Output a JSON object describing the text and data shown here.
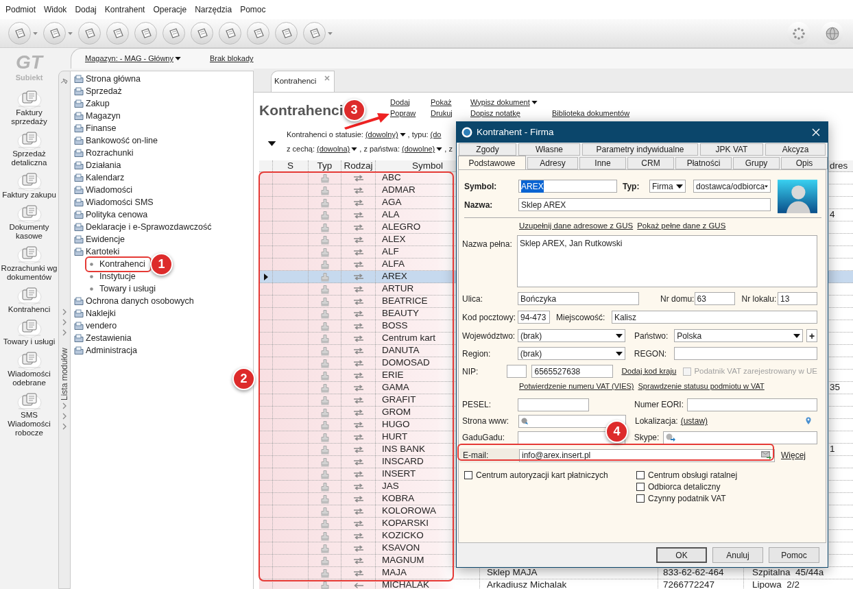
{
  "menu": [
    "Podmiot",
    "Widok",
    "Dodaj",
    "Kontrahent",
    "Operacje",
    "Narzędzia",
    "Pomoc"
  ],
  "toolbar": [
    {
      "dropdown": true
    },
    {
      "dropdown": true
    },
    {
      "dropdown": false
    },
    {
      "dropdown": false
    },
    {
      "dropdown": false
    },
    {
      "dropdown": false
    },
    {
      "dropdown": false
    },
    {
      "dropdown": false
    },
    {
      "dropdown": false
    },
    {
      "dropdown": false
    },
    {
      "dropdown": true
    }
  ],
  "logo": {
    "mark": "GT",
    "name": "Subiekt"
  },
  "nav": [
    "Faktury sprzedaży",
    "Sprzedaż detaliczna",
    "Faktury zakupu",
    "Dokumenty kasowe",
    "Rozrachunki wg dokumentów",
    "Kontrahenci",
    "Towary i usługi",
    "Wiadomości odebrane",
    "SMS Wiadomości robocze"
  ],
  "band": {
    "warehouse": "Magazyn: - MAG - Główny",
    "lock": "Brak blokady"
  },
  "modules": {
    "strip_label": "Lista modułów",
    "items": [
      {
        "label": "Strona główna"
      },
      {
        "label": "Sprzedaż"
      },
      {
        "label": "Zakup"
      },
      {
        "label": "Magazyn"
      },
      {
        "label": "Finanse"
      },
      {
        "label": "Bankowość on-line"
      },
      {
        "label": "Rozrachunki"
      },
      {
        "label": "Działania"
      },
      {
        "label": "Kalendarz"
      },
      {
        "label": "Wiadomości"
      },
      {
        "label": "Wiadomości SMS"
      },
      {
        "label": "Polityka cenowa"
      },
      {
        "label": "Deklaracje i e-Sprawozdawczość"
      },
      {
        "label": "Ewidencje"
      },
      {
        "label": "Kartoteki",
        "children": [
          {
            "label": "Kontrahenci"
          },
          {
            "label": "Instytucje"
          },
          {
            "label": "Towary i usługi"
          }
        ]
      },
      {
        "label": "Ochrona danych osobowych"
      },
      {
        "label": "Naklejki"
      },
      {
        "label": "vendero"
      },
      {
        "label": "Zestawienia"
      },
      {
        "label": "Administracja"
      }
    ]
  },
  "tab": {
    "label": "Kontrahenci"
  },
  "heading": "Kontrahenci",
  "actions": [
    [
      {
        "label": "Dodaj",
        "dropdown": false
      },
      {
        "label": "Pokaż",
        "dropdown": false
      },
      {
        "label": "Wypisz dokument",
        "dropdown": true
      }
    ],
    [
      {
        "label": "Popraw",
        "dropdown": false
      },
      {
        "label": "Drukuj",
        "dropdown": false
      },
      {
        "label": "Dopisz notatkę",
        "dropdown": false
      },
      {
        "label": "Biblioteka dokumentów",
        "dropdown": false
      }
    ]
  ],
  "filters": [
    [
      {
        "kind": "text",
        "text": "Kontrahenci o statusie:"
      },
      {
        "kind": "choice",
        "text": "(dowolny)"
      },
      {
        "kind": "text",
        "text": ", typu:"
      },
      {
        "kind": "cut",
        "text": "(do"
      }
    ],
    [
      {
        "kind": "text",
        "text": "z cechą:"
      },
      {
        "kind": "choice",
        "text": "(dowolna)"
      },
      {
        "kind": "text",
        "text": ", z państwa:"
      },
      {
        "kind": "choice",
        "text": "(dowolne)"
      },
      {
        "kind": "text",
        "text": ", z"
      }
    ]
  ],
  "table": {
    "columns": {
      "s": "S",
      "typ": "Typ",
      "rodzaj": "Rodzaj",
      "symbol": "Symbol",
      "column_8": "dres"
    },
    "rows": [
      {
        "symbol": "ABC",
        "kind": "both",
        "selected": false
      },
      {
        "symbol": "ADMAR",
        "kind": "both",
        "selected": false
      },
      {
        "symbol": "AGA",
        "kind": "both",
        "selected": false
      },
      {
        "symbol": "ALA",
        "kind": "both",
        "selected": false,
        "adres": "4"
      },
      {
        "symbol": "ALEGRO",
        "kind": "both",
        "selected": false
      },
      {
        "symbol": "ALEX",
        "kind": "both",
        "selected": false
      },
      {
        "symbol": "ALF",
        "kind": "both",
        "selected": false
      },
      {
        "symbol": "ALFA",
        "kind": "both",
        "selected": false
      },
      {
        "symbol": "AREX",
        "kind": "both",
        "selected": true
      },
      {
        "symbol": "ARTUR",
        "kind": "both",
        "selected": false
      },
      {
        "symbol": "BEATRICE",
        "kind": "both",
        "selected": false
      },
      {
        "symbol": "BEAUTY",
        "kind": "both",
        "selected": false
      },
      {
        "symbol": "BOSS",
        "kind": "both",
        "selected": false
      },
      {
        "symbol": "Centrum kart",
        "kind": "both",
        "selected": false
      },
      {
        "symbol": "DANUTA",
        "kind": "both",
        "selected": false
      },
      {
        "symbol": "DOMOSAD",
        "kind": "both",
        "selected": false
      },
      {
        "symbol": "ERIE",
        "kind": "both",
        "selected": false
      },
      {
        "symbol": "GAMA",
        "kind": "both",
        "selected": false,
        "adres": "35"
      },
      {
        "symbol": "GRAFIT",
        "kind": "both",
        "selected": false
      },
      {
        "symbol": "GROM",
        "kind": "both",
        "selected": false
      },
      {
        "symbol": "HUGO",
        "kind": "both",
        "selected": false
      },
      {
        "symbol": "HURT",
        "kind": "both",
        "selected": false
      },
      {
        "symbol": "INS BANK",
        "kind": "both",
        "selected": false,
        "adres": "1"
      },
      {
        "symbol": "INSCARD",
        "kind": "both",
        "selected": false
      },
      {
        "symbol": "INSERT",
        "kind": "both",
        "selected": false
      },
      {
        "symbol": "JAS",
        "kind": "both",
        "selected": false
      },
      {
        "symbol": "KOBRA",
        "kind": "both",
        "selected": false
      },
      {
        "symbol": "KOLOROWA",
        "kind": "both",
        "selected": false
      },
      {
        "symbol": "KOPARSKI",
        "kind": "both",
        "selected": false
      },
      {
        "symbol": "KOZICKO",
        "kind": "both",
        "selected": false
      },
      {
        "symbol": "KSAVON",
        "kind": "both",
        "selected": false
      },
      {
        "symbol": "MAGNUM",
        "kind": "both",
        "selected": false
      },
      {
        "symbol": "MAJA",
        "kind": "both",
        "selected": false,
        "nazwa": "Sklep MAJA",
        "nip": "833-62-62-464",
        "adres": "Szpitalna  45/44a"
      },
      {
        "symbol": "MICHALAK",
        "kind": "in",
        "selected": false,
        "nazwa": "Arkadiusz Michalak",
        "nip": "7266772247",
        "adres": "Lipowa  2/2"
      }
    ]
  },
  "dialog": {
    "title": "Kontrahent - Firma",
    "tab_rows": [
      [
        {
          "label": "Zgody",
          "selected": false
        },
        {
          "label": "Własne",
          "selected": false
        },
        {
          "label": "Parametry indywidualne",
          "selected": false
        },
        {
          "label": "JPK VAT",
          "selected": false
        },
        {
          "label": "Akcyza",
          "selected": false
        }
      ],
      [
        {
          "label": "Podstawowe",
          "selected": true
        },
        {
          "label": "Adresy",
          "selected": false
        },
        {
          "label": "Inne",
          "selected": false
        },
        {
          "label": "CRM",
          "selected": false
        },
        {
          "label": "Płatności",
          "selected": false
        },
        {
          "label": "Grupy",
          "selected": false
        },
        {
          "label": "Opis",
          "selected": false
        }
      ]
    ],
    "form": {
      "symbol": {
        "label": "Symbol:",
        "value": "AREX",
        "highlighted": true
      },
      "typ": {
        "label": "Typ:",
        "value": "Firma"
      },
      "rodzaj": {
        "value": "dostawca/odbiorca"
      },
      "nazwa": {
        "label": "Nazwa:",
        "value": "Sklep AREX"
      },
      "gus_links": [
        "Uzupełnij dane adresowe z GUS",
        "Pokaż pełne dane z GUS"
      ],
      "nazwa_pelna": {
        "label": "Nazwa pełna:",
        "value": "Sklep AREX, Jan Rutkowski"
      },
      "ulica": {
        "label": "Ulica:",
        "value": "Bończyka"
      },
      "nr_domu": {
        "label": "Nr domu:",
        "value": "63"
      },
      "nr_lokalu": {
        "label": "Nr lokalu:",
        "value": "13"
      },
      "kod": {
        "label": "Kod pocztowy:",
        "value": "94-473"
      },
      "miejscowosc": {
        "label": "Miejscowość:",
        "value": "Kalisz"
      },
      "wojewodztwo": {
        "label": "Województwo:",
        "value": "(brak)"
      },
      "panstwo": {
        "label": "Państwo:",
        "value": "Polska",
        "add_button": "+"
      },
      "region": {
        "label": "Region:",
        "value": "(brak)"
      },
      "regon": {
        "label": "REGON:"
      },
      "nip": {
        "label": "NIP:",
        "value": "6565527638",
        "link": "Dodaj kod kraju"
      },
      "vat_ue": {
        "label": "Podatnik VAT zarejestrowany w UE",
        "checked": false,
        "disabled": true
      },
      "vat_links": [
        "Potwierdzenie numeru VAT (VIES)",
        "Sprawdzenie statusu podmiotu w VAT"
      ],
      "pesel": {
        "label": "PESEL:"
      },
      "eori": {
        "label": "Numer EORI:"
      },
      "www": {
        "label": "Strona www:"
      },
      "lokalizacja": {
        "label": "Lokalizacja:",
        "link": "(ustaw)"
      },
      "gadugadu": {
        "label": "GaduGadu:"
      },
      "skype": {
        "label": "Skype:"
      },
      "email": {
        "label": "E-mail:",
        "value": "info@arex.insert.pl",
        "more": "Więcej"
      },
      "checkboxes": [
        {
          "label": "Centrum autoryzacji kart płatniczych",
          "checked": false
        },
        {
          "label": "Centrum obsługi ratalnej",
          "checked": false
        },
        {
          "label": "Odbiorca detaliczny",
          "checked": false
        },
        {
          "label": "Czynny podatnik VAT",
          "checked": false
        }
      ]
    },
    "buttons": [
      {
        "label": "OK",
        "default": true
      },
      {
        "label": "Anuluj",
        "default": false
      },
      {
        "label": "Pomoc",
        "default": false
      }
    ]
  },
  "annotations": [
    {
      "label": "1",
      "kind": "outline"
    },
    {
      "label": "2",
      "kind": "outline"
    },
    {
      "label": "3",
      "kind": "arrow"
    },
    {
      "label": "4",
      "kind": "outline"
    }
  ]
}
